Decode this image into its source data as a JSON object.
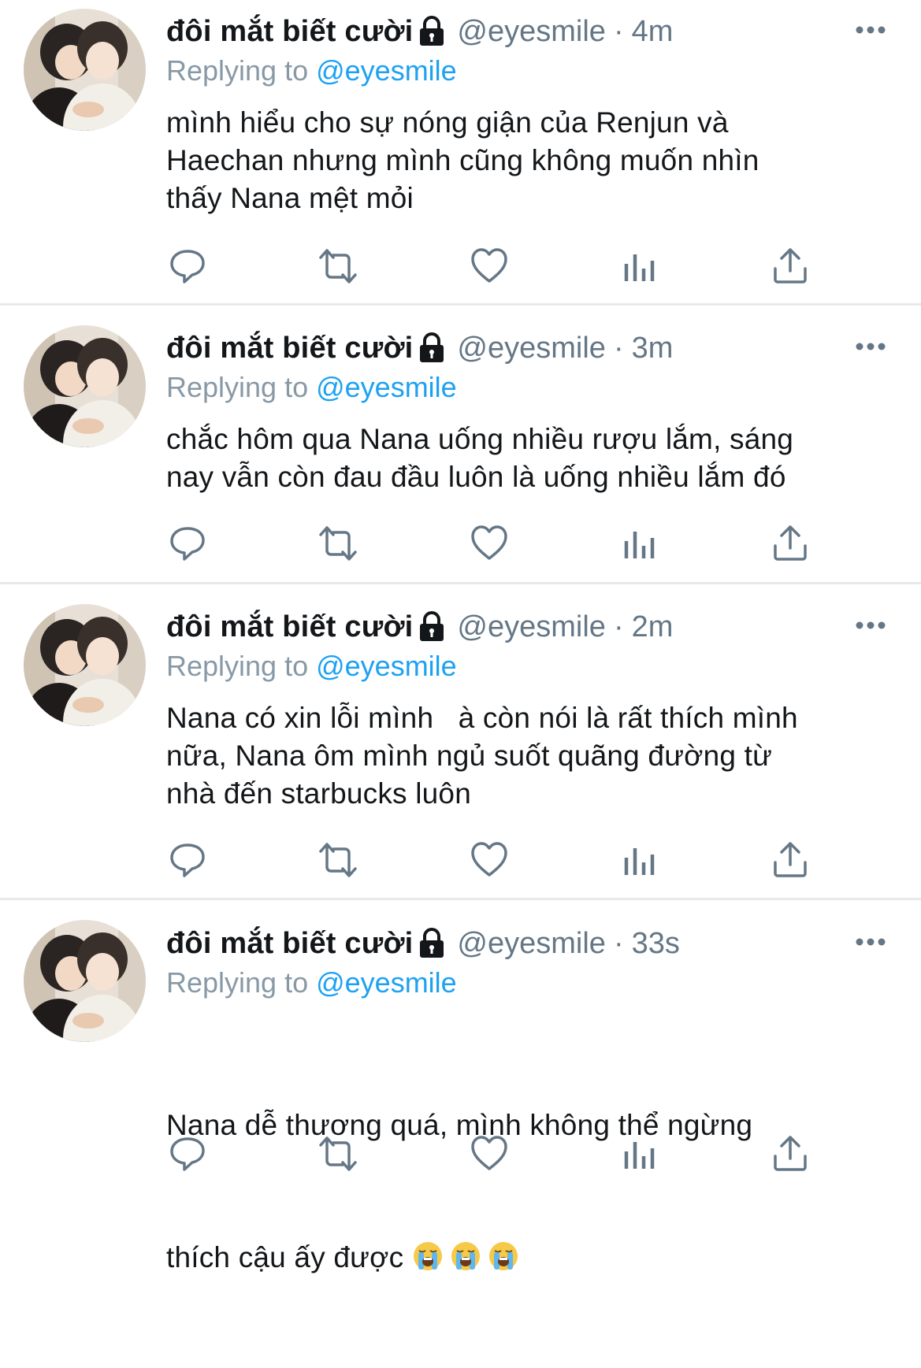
{
  "user": {
    "name": "đôi mắt biết cười",
    "handle": "@eyesmile",
    "separator": "·",
    "avatar_icon": "profile-photo"
  },
  "reply": {
    "prefix": "Replying to ",
    "mention": "@eyesmile"
  },
  "tweets": [
    {
      "time": "4m",
      "text": "mình hiểu cho sự nóng giận của Renjun và\nHaechan nhưng mình cũng không muốn nhìn\nthấy Nana mệt mỏi"
    },
    {
      "time": "3m",
      "text": "chắc hôm qua Nana uống nhiều rượu lắm, sáng\nnay vẫn còn đau đầu luôn là uống nhiều lắm đó"
    },
    {
      "time": "2m",
      "text": "Nana có xin lỗi mình   à còn nói là rất thích mình\nnữa, Nana ôm mình ngủ suốt quãng đường từ\nnhà đến starbucks luôn"
    },
    {
      "time": "33s",
      "text_line1": "Nana dễ thương quá, mình không thể ngừng",
      "text_line2": "thích cậu ấy được ",
      "emoji": [
        "loudly-crying-face",
        "loudly-crying-face",
        "loudly-crying-face"
      ]
    }
  ],
  "icons": {
    "reply": "comment-icon",
    "retweet": "retweet-icon",
    "like": "heart-icon",
    "analytics": "analytics-icon",
    "share": "share-icon",
    "more": "more-options-icon",
    "lock": "lock-icon"
  },
  "colors": {
    "name": "#14171a",
    "secondary": "#657786",
    "mention": "#1da1f2",
    "divider": "#e6e9ec",
    "icon": "#657786"
  }
}
